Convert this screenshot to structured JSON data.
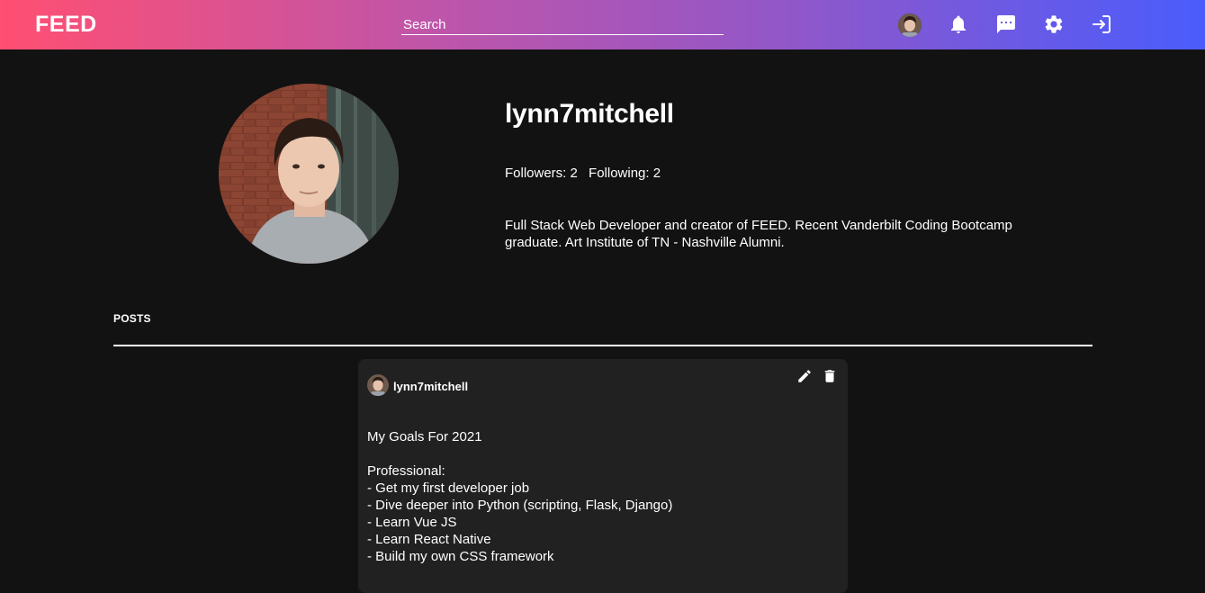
{
  "header": {
    "logo": "FEED",
    "search": {
      "placeholder": "Search",
      "value": ""
    },
    "icons": [
      "avatar",
      "bell-icon",
      "chat-icon",
      "gear-icon",
      "logout-icon"
    ]
  },
  "profile": {
    "username": "lynn7mitchell",
    "followers_label": "Followers: 2",
    "following_label": "Following: 2",
    "bio": "Full Stack Web Developer and creator of FEED. Recent Vanderbilt Coding Bootcamp graduate. Art Institute of TN - Nashville Alumni."
  },
  "posts_section": {
    "heading": "POSTS"
  },
  "post": {
    "author": "lynn7mitchell",
    "lines": [
      "My Goals For 2021",
      "",
      "Professional:",
      "- Get my first developer job",
      "- Dive deeper into Python (scripting, Flask, Django)",
      "- Learn Vue JS",
      "- Learn React Native",
      "- Build my own CSS framework"
    ]
  },
  "colors": {
    "header_gradient_start": "#ff4f72",
    "header_gradient_end": "#4a5cfc",
    "background": "#121212",
    "card": "#212121"
  }
}
